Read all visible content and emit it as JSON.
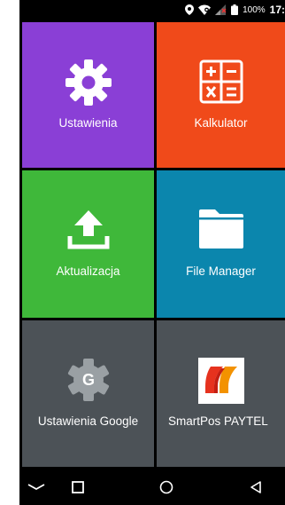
{
  "status_bar": {
    "battery_percent": "100%",
    "time": "17:"
  },
  "tiles": [
    {
      "label": "Ustawienia",
      "icon": "gear-icon",
      "color": "#8a3fd6"
    },
    {
      "label": "Kalkulator",
      "icon": "calculator-icon",
      "color": "#f04a1a"
    },
    {
      "label": "Aktualizacja",
      "icon": "upload-icon",
      "color": "#3fb83a"
    },
    {
      "label": "File Manager",
      "icon": "folder-icon",
      "color": "#0b86ad"
    },
    {
      "label": "Ustawienia Google",
      "icon": "google-settings-icon",
      "color": "#4c5257"
    },
    {
      "label": "SmartPos PAYTEL",
      "icon": "paytel-logo-icon",
      "color": "#4c5257"
    }
  ],
  "nav_bar": {
    "icons": [
      "hide-keyboard-icon",
      "recents-icon",
      "home-icon",
      "back-icon"
    ]
  }
}
